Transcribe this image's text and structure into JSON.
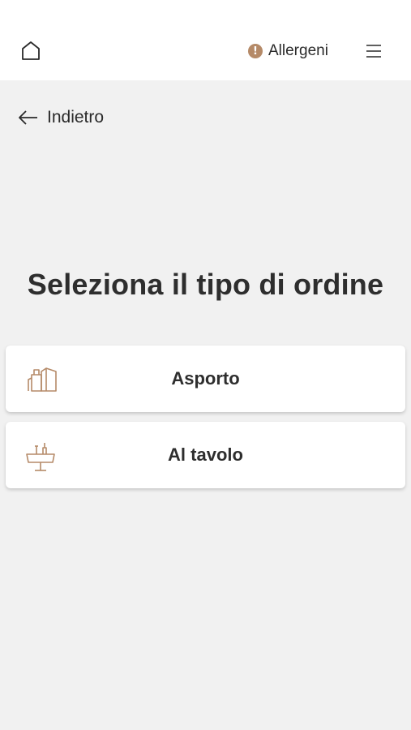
{
  "header": {
    "home_icon": "home-icon",
    "allergens_label": "Allergeni",
    "allergens_icon": "alert-circle-icon",
    "allergens_icon_glyph": "!",
    "menu_icon": "hamburger-menu-icon"
  },
  "nav": {
    "back_label": "Indietro",
    "back_icon": "arrow-left-icon"
  },
  "main": {
    "title": "Seleziona il tipo di ordine",
    "options": [
      {
        "label": "Asporto",
        "icon": "takeaway-bag-icon"
      },
      {
        "label": "Al tavolo",
        "icon": "dining-table-icon"
      }
    ]
  },
  "colors": {
    "accent": "#b58a68",
    "background": "#f1f1f1",
    "header_bg": "#ffffff",
    "text": "#2a2a2a"
  }
}
